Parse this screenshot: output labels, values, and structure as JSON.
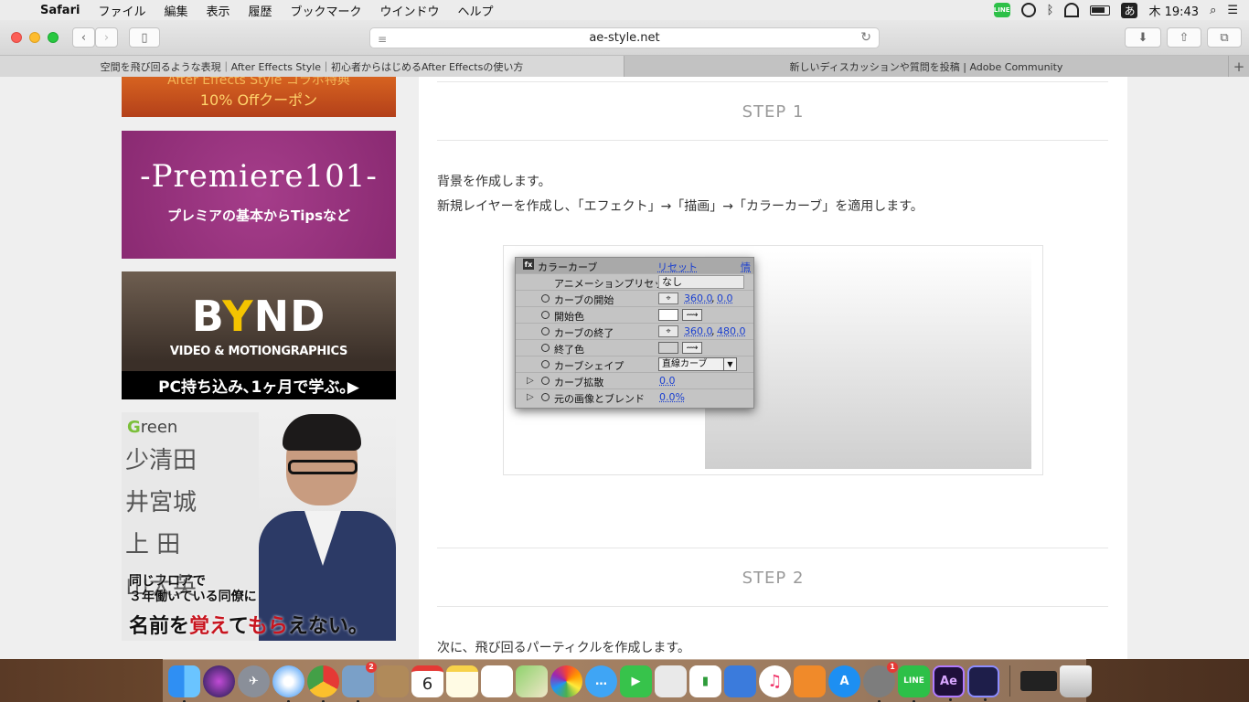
{
  "menubar": {
    "app_name": "Safari",
    "items": [
      "ファイル",
      "編集",
      "表示",
      "履歴",
      "ブックマーク",
      "ウインドウ",
      "ヘルプ"
    ],
    "line_label": "LINE",
    "ime": "あ",
    "clock": "木 19:43"
  },
  "toolbar": {
    "url": "ae-style.net"
  },
  "tabs": [
    "空間を飛び回るような表現｜After Effects Style｜初心者からはじめるAfter Effectsの使い方",
    "新しいディスカッションや質問を投稿 | Adobe Community"
  ],
  "sidebar": {
    "coupon": {
      "line1": "After Effects Style コラボ特典",
      "line2": "10% Offクーポン"
    },
    "premiere": {
      "title": "-Premiere101-",
      "subtitle": "プレミアの基本からTipsなど"
    },
    "bynd": {
      "logo_b": "B",
      "logo_y": "Y",
      "logo_nd": "ND",
      "subtitle": "VIDEO & MOTIONGRAPHICS",
      "bar": "PC持ち込み､1ヶ月で学ぶ｡▶"
    },
    "green": {
      "brand_g": "G",
      "brand_rest": "reen",
      "board": [
        "少清田",
        "井宮城",
        "上 田",
        "山大英"
      ],
      "copy_line1": "同じフロアで",
      "copy_line2": "３年働いている同僚に",
      "copy_a": "名前を",
      "copy_red1": "覚え",
      "copy_b": "て",
      "copy_red2": "もら",
      "copy_c": "えない。"
    }
  },
  "content": {
    "step1": "STEP 1",
    "para1": "背景を作成します。",
    "para2": "新規レイヤーを作成し、「エフェクト」→「描画」→「カラーカーブ」を適用します。",
    "step2": "STEP 2",
    "para3": "次に、飛び回るパーティクルを作成します。"
  },
  "ae_panel": {
    "title": "カラーカーブ",
    "reset": "リセット",
    "info": "情",
    "preset_label": "アニメーションプリセット :",
    "preset_value": "なし",
    "start_label": "カーブの開始",
    "start_x": "360.0",
    "start_y": "0.0",
    "start_color_label": "開始色",
    "end_label": "カーブの終了",
    "end_x": "360.0",
    "end_y": "480.0",
    "end_color_label": "終了色",
    "shape_label": "カーブシェイプ",
    "shape_value": "直線カーブ",
    "diffuse_label": "カーブ拡散",
    "diffuse_value": "0.0",
    "blend_label": "元の画像とブレンド",
    "blend_value": "0.0%",
    "colors": {
      "start": "#ffffff",
      "end": "#d0d0d0"
    }
  },
  "dock": {
    "calendar_day": "6",
    "photos_badge": "2",
    "prefs_badge": "1",
    "ae_label": "Ae",
    "line_label": "LINE",
    "items": [
      "finder-icon",
      "siri-icon",
      "launchpad-icon",
      "safari-icon",
      "chrome-icon",
      "preview-icon",
      "contacts-icon",
      "calendar-icon",
      "notes-icon",
      "reminders-icon",
      "maps-icon",
      "photos-icon",
      "messages-icon",
      "facetime-icon",
      "keynote-icon",
      "numbers-icon",
      "keynote-present-icon",
      "music-icon",
      "books-icon",
      "appstore-icon",
      "system-preferences-icon",
      "line-icon",
      "after-effects-icon",
      "media-encoder-icon",
      "screen-icon",
      "trash-icon"
    ]
  }
}
